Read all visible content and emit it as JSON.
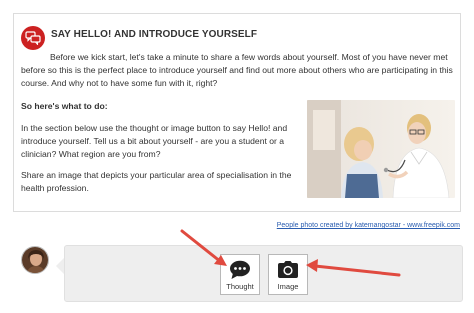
{
  "card": {
    "title": "SAY HELLO! AND INTRODUCE YOURSELF",
    "intro": "Before we kick start, let's take a minute to share a few words about yourself. Most of you have never met before so this is the perfect place to introduce yourself and find out more about others who are participating in this course. And why not to have some fun with it, right?",
    "subheading": "So here's what to do:",
    "instruction": "In the section below use the thought or image button to say Hello! and introduce yourself. Tell us a bit about yourself - are you a student or a clinician? What region are you from?",
    "share": "Share an image that depicts your particular area of specialisation in the health profession.",
    "header_icon": "speech-bubbles-icon",
    "photo_icon": "doctor-with-child-photo"
  },
  "credit": {
    "text": "People photo created by katemangostar - www.freepik.com"
  },
  "composer": {
    "avatar_icon": "user-avatar",
    "buttons": [
      {
        "label": "Thought",
        "icon": "chat-bubble-icon"
      },
      {
        "label": "Image",
        "icon": "camera-icon"
      }
    ]
  },
  "annotations": {
    "arrow_color": "#e04a3f"
  },
  "colors": {
    "accent_red": "#cc2121",
    "link_blue": "#2a5db0"
  }
}
